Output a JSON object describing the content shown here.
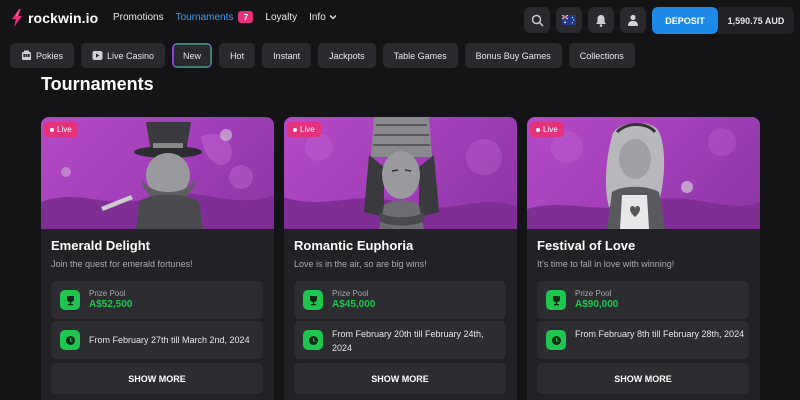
{
  "header": {
    "logo_text": "rockwin.io",
    "nav": [
      {
        "label": "Promotions"
      },
      {
        "label": "Tournaments",
        "badge": "7"
      },
      {
        "label": "Loyalty"
      },
      {
        "label": "Info"
      }
    ],
    "deposit_label": "DEPOSIT",
    "balance": "1,590.75 AUD"
  },
  "categories": [
    {
      "label": "Pokies",
      "icon": "slot-machine-icon"
    },
    {
      "label": "Live Casino",
      "icon": "play-icon"
    },
    {
      "label": "New"
    },
    {
      "label": "Hot"
    },
    {
      "label": "Instant"
    },
    {
      "label": "Jackpots"
    },
    {
      "label": "Table Games"
    },
    {
      "label": "Bonus Buy Games"
    },
    {
      "label": "Collections"
    }
  ],
  "page_title": "Tournaments",
  "tournaments": [
    {
      "badge": "Live",
      "title": "Emerald Delight",
      "subtitle": "Join the quest for emerald fortunes!",
      "prize_label": "Prize Pool",
      "prize_value": "A$52,500",
      "dates": "From February 27th till March 2nd, 2024",
      "button": "SHOW MORE"
    },
    {
      "badge": "Live",
      "title": "Romantic Euphoria",
      "subtitle": "Love is in the air, so are big wins!",
      "prize_label": "Prize Pool",
      "prize_value": "A$45,000",
      "dates": "From February 20th till February 24th, 2024",
      "button": "SHOW MORE"
    },
    {
      "badge": "Live",
      "title": "Festival of Love",
      "subtitle": "It's time to fall in love with winning!",
      "prize_label": "Prize Pool",
      "prize_value": "A$90,000",
      "dates": "From February 8th till February 28th, 2024",
      "button": "SHOW MORE"
    }
  ],
  "colors": {
    "accent_blue": "#1e8ae8",
    "live_pink": "#e4317b",
    "prize_green": "#1ec64f",
    "banner_purple": "#a23fb9"
  }
}
